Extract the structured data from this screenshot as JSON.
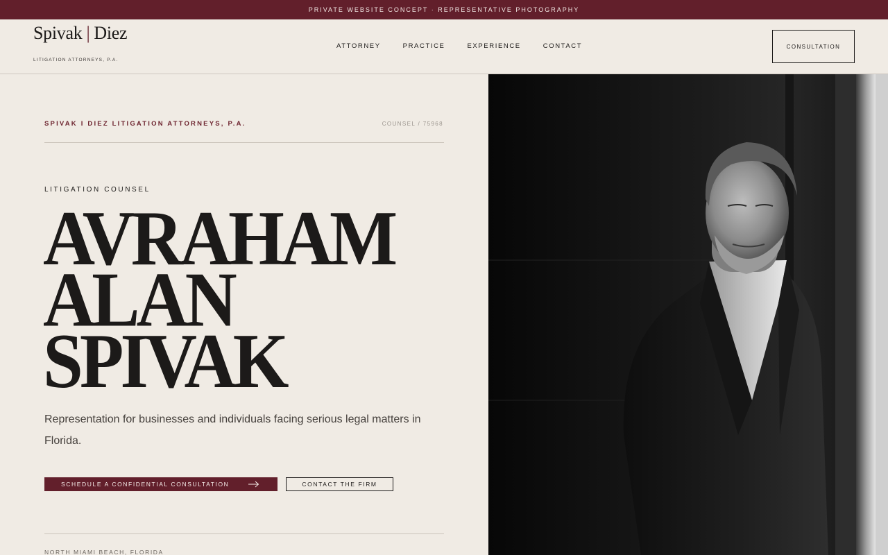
{
  "banner": {
    "text": "PRIVATE WEBSITE CONCEPT · REPRESENTATIVE PHOTOGRAPHY"
  },
  "header": {
    "logo_left": "Spivak",
    "logo_sep": "|",
    "logo_right": "Diez",
    "logo_sub": "LITIGATION ATTORNEYS, P.A.",
    "nav": [
      "ATTORNEY",
      "PRACTICE",
      "EXPERIENCE",
      "CONTACT"
    ],
    "cta": "CONSULTATION"
  },
  "hero": {
    "firm_line": "SPIVAK I DIEZ LITIGATION ATTORNEYS, P.A.",
    "counsel_id": "COUNSEL / 75968",
    "eyebrow": "LITIGATION COUNSEL",
    "name_lines": [
      "AVRAHAM",
      "ALAN",
      "SPIVAK"
    ],
    "lead": "Representation for businesses and individuals facing serious legal matters in Florida.",
    "primary_button": "SCHEDULE A CONFIDENTIAL CONSULTATION",
    "secondary_button": "CONTACT THE FIRM",
    "location": "NORTH MIAMI BEACH, FLORIDA"
  },
  "colors": {
    "accent": "#621f2b",
    "background": "#f0ebe4",
    "text": "#1c1a19"
  },
  "icons": {
    "primary_button_icon": "arrow-right-icon"
  }
}
